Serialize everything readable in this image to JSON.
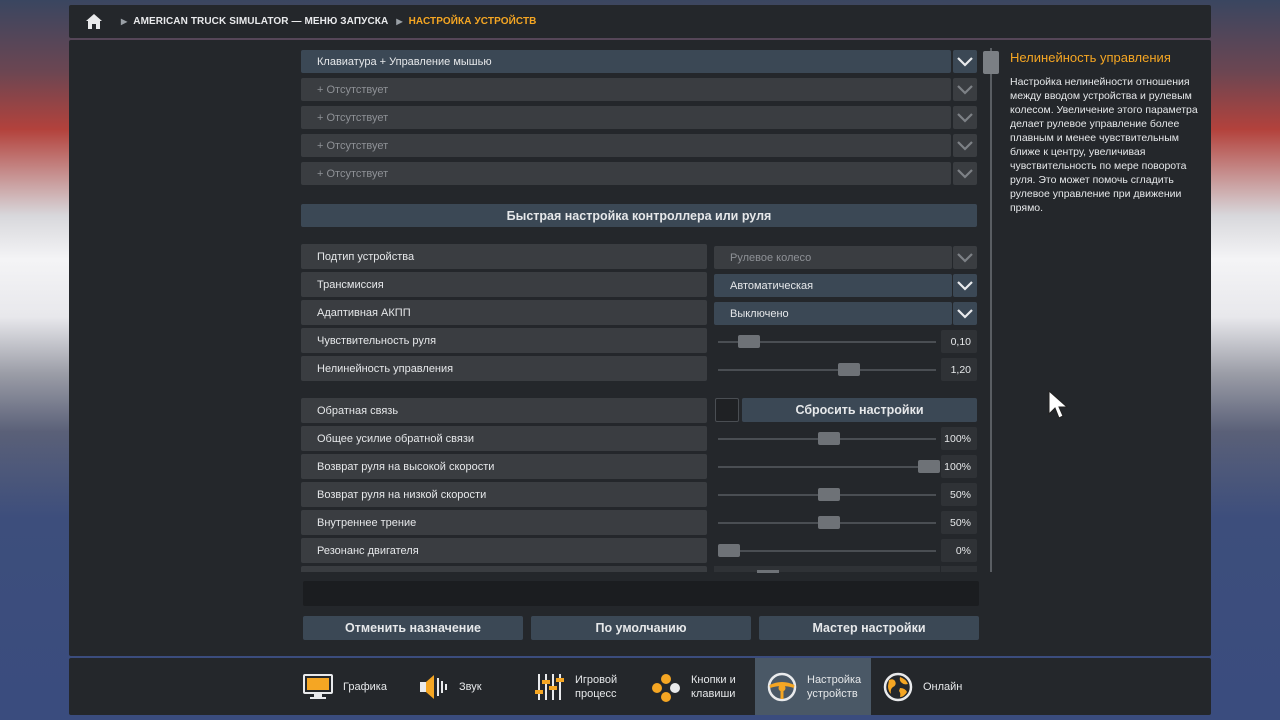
{
  "breadcrumb": {
    "home_icon": "home-icon",
    "items": [
      "AMERICAN TRUCK SIMULATOR — МЕНЮ ЗАПУСКА",
      "НАСТРОЙКА УСТРОЙСТВ"
    ]
  },
  "devices": [
    {
      "label": "Клавиатура + Управление мышью"
    },
    {
      "label": "+ Отсутствует"
    },
    {
      "label": "+ Отсутствует"
    },
    {
      "label": "+ Отсутствует"
    },
    {
      "label": "+ Отсутствует"
    }
  ],
  "quick_setup": {
    "title": "Быстрая настройка контроллера или руля",
    "rows": [
      {
        "label": "Подтип устройства",
        "value": "Рулевое колесо"
      },
      {
        "label": "Трансмиссия",
        "value": "Автоматическая"
      },
      {
        "label": "Адаптивная АКПП",
        "value": "Выключено"
      }
    ],
    "sliders": [
      {
        "label": "Чувствительность руля",
        "value": "0,10",
        "fraction": 0.1
      },
      {
        "label": "Нелинейность управления",
        "value": "1,20",
        "fraction": 0.6
      }
    ]
  },
  "feedback": {
    "label": "Обратная связь",
    "checked": false,
    "reset_label": "Сбросить настройки",
    "sliders": [
      {
        "label": "Общее усилие обратной связи",
        "value": "100%",
        "fraction": 0.5
      },
      {
        "label": "Возврат руля на высокой скорости",
        "value": "100%",
        "fraction": 1.0
      },
      {
        "label": "Возврат руля на низкой скорости",
        "value": "50%",
        "fraction": 0.5
      },
      {
        "label": "Внутреннее трение",
        "value": "50%",
        "fraction": 0.5
      },
      {
        "label": "Резонанс двигателя",
        "value": "0%",
        "fraction": 0.0
      }
    ]
  },
  "help": {
    "title": "Нелинейность управления",
    "text": "Настройка нелинейности отношения между вводом устройства и рулевым колесом. Увеличение этого параметра делает рулевое управление более плавным и менее чувствительным ближе к центру, увеличивая чувствительность по мере поворота руля. Это может помочь сгладить рулевое управление при движении прямо."
  },
  "actions": {
    "unassign": "Отменить назначение",
    "defaults": "По умолчанию",
    "wizard": "Мастер настройки"
  },
  "tabs": [
    {
      "label": "Графика",
      "icon": "monitor-icon"
    },
    {
      "label": "Звук",
      "icon": "speaker-icon"
    },
    {
      "label": "Игровой процесс",
      "icon": "sliders-icon"
    },
    {
      "label": "Кнопки и клавиши",
      "icon": "gamepad-icon"
    },
    {
      "label": "Настройка устройств",
      "icon": "steering-wheel-icon",
      "active": true
    },
    {
      "label": "Онлайн",
      "icon": "globe-icon"
    }
  ],
  "colors": {
    "accent": "#f5a623",
    "panel": "#24272b",
    "highlight": "#3b4855"
  }
}
